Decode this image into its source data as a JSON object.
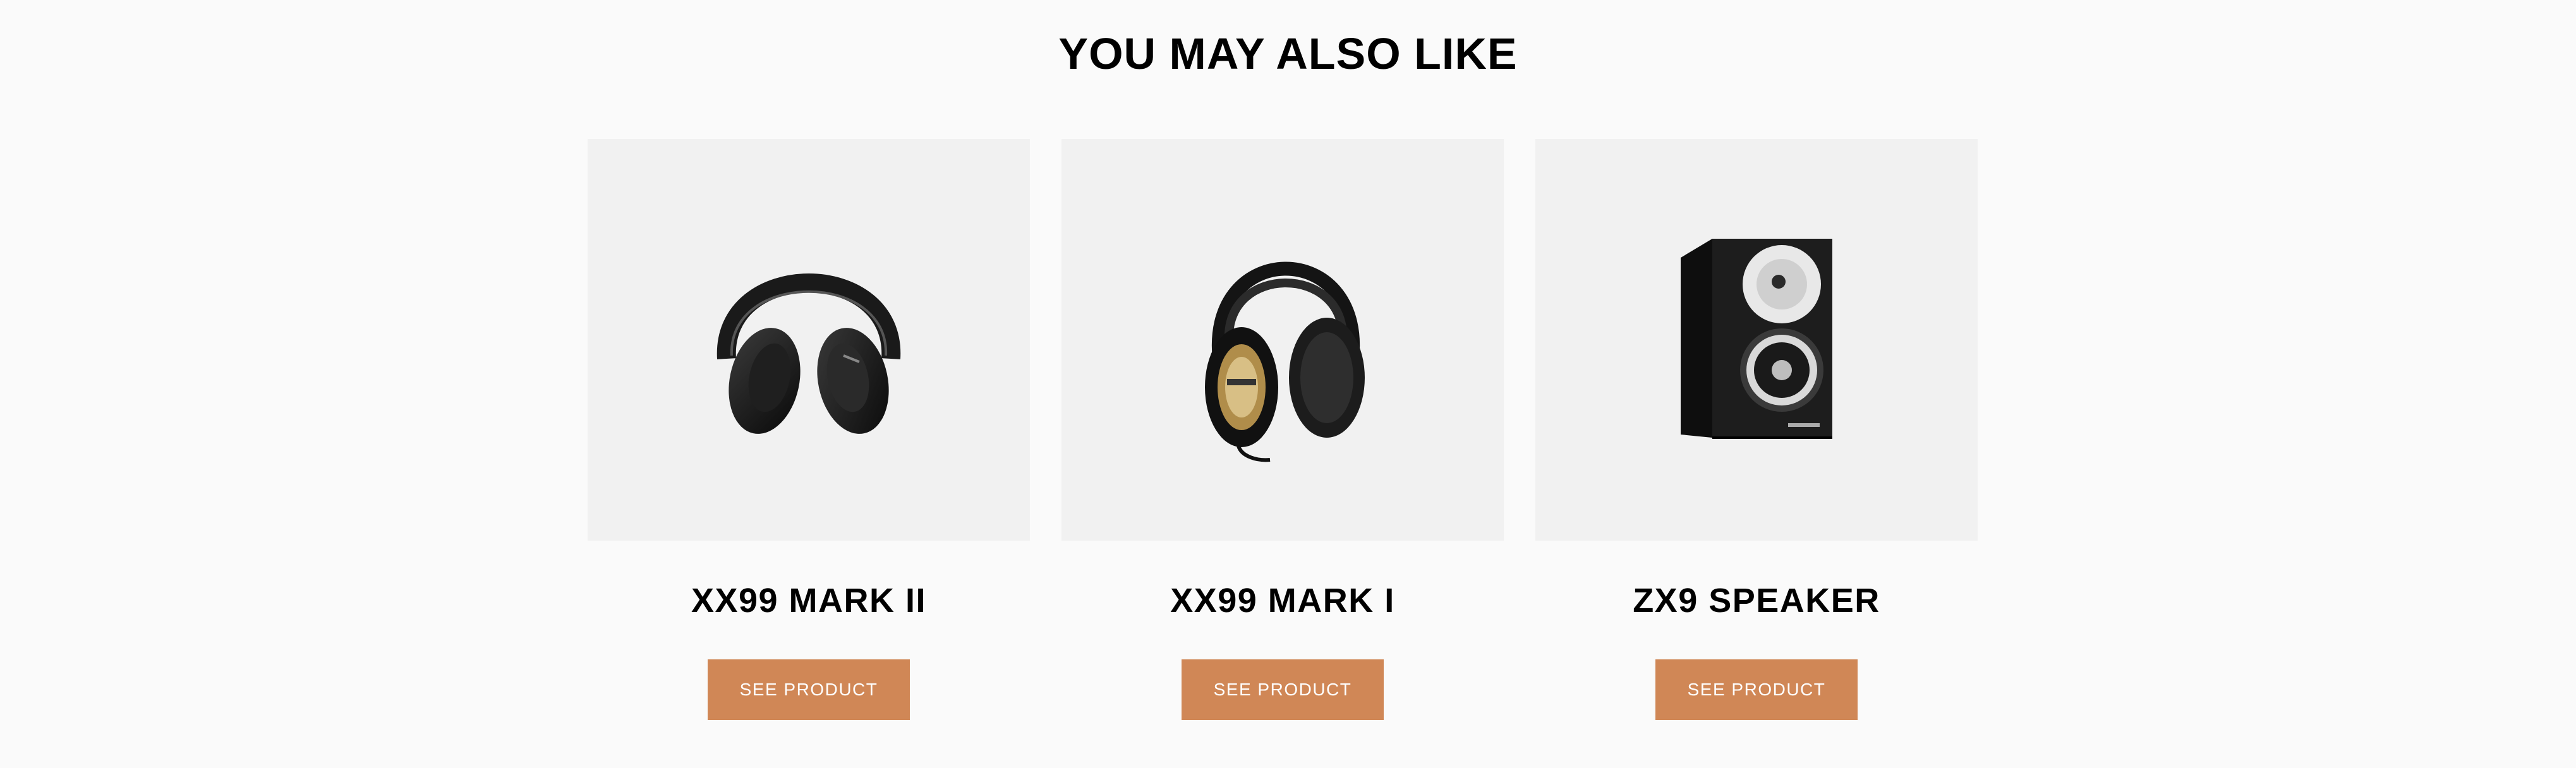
{
  "section": {
    "title": "YOU MAY ALSO LIKE"
  },
  "products": [
    {
      "name": "XX99 MARK II",
      "button_label": "SEE PRODUCT",
      "image_icon": "over-ear-headphones-icon"
    },
    {
      "name": "XX99 MARK I",
      "button_label": "SEE PRODUCT",
      "image_icon": "studio-headphones-icon"
    },
    {
      "name": "ZX9 SPEAKER",
      "button_label": "SEE PRODUCT",
      "image_icon": "bookshelf-speaker-icon"
    }
  ],
  "colors": {
    "accent": "#d08756",
    "card_background": "#f1f1f1",
    "page_background": "#fafafa"
  }
}
